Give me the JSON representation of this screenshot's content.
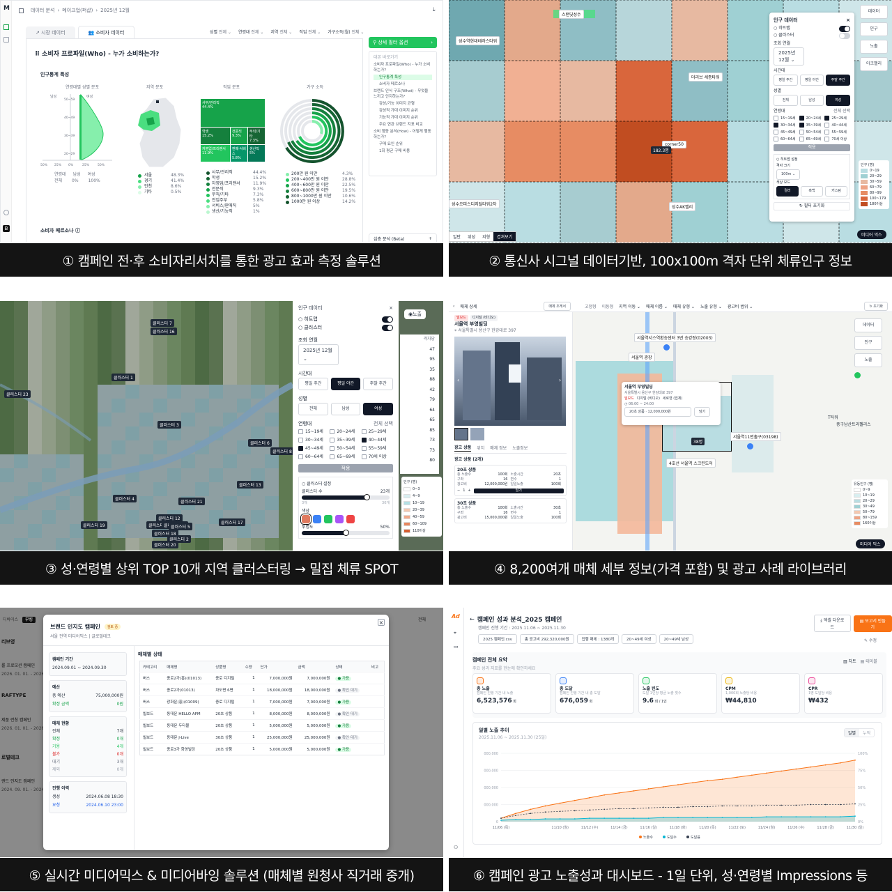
{
  "captions": [
    "① 캠페인 전·후 소비자리서치를 통한 광고 효과 측정 솔루션",
    "② 통신사 시그널 데이터기반, 100x100m 격자 단위 체류인구 정보",
    "③ 성·연령별 상위 TOP 10개 지역 클러스터링 → 밀집 체류 SPOT",
    "④ 8,200여개 매체 세부 정보(가격 포함) 및 광고 사례 라이브러리",
    "⑤ 실시간 미디어믹스 & 미디어바잉 솔루션 (매체별 원청사 직거래 중개)",
    "⑥ 캠페인 광고 노출성과 대시보드 - 1일 단위, 성·연령별 Impressions 등"
  ],
  "p1": {
    "logo": "M",
    "breadcrumb": [
      "데이터 분석",
      "메이크업(퍼샵)",
      "2025년 12월"
    ],
    "tabs": [
      "시장 데이터",
      "소비자 데이터"
    ],
    "filters": [
      {
        "label": "성별",
        "value": "전체"
      },
      {
        "label": "연령대",
        "value": "전체"
      },
      {
        "label": "지역",
        "value": "전체"
      },
      {
        "label": "직업",
        "value": "전체"
      },
      {
        "label": "가구소득(월)",
        "value": "전체"
      }
    ],
    "title": "소비자 프로파일(Who) - 누가 소비하는가?",
    "section": "인구통계 특성",
    "sub_titles": [
      "연령대별 성별 분포",
      "지역 분포",
      "직업 분포",
      "가구 소득"
    ],
    "pyramid_labels": [
      "남성",
      "여성"
    ],
    "pyramid_ages": [
      "50~59",
      "40~49",
      "30~39",
      "20~29"
    ],
    "pyramid_axis": [
      "50%",
      "25%",
      "0%",
      "25%",
      "50%"
    ],
    "pyramid_legend": {
      "headers": [
        "연령대",
        "남성",
        "여성"
      ],
      "row": [
        "전체",
        "0%",
        "100%"
      ]
    },
    "region_legend": [
      {
        "name": "서울",
        "value": "48.3%",
        "color": "#16a34a"
      },
      {
        "name": "경기",
        "value": "41.4%",
        "color": "#4ade80"
      },
      {
        "name": "인천",
        "value": "8.6%",
        "color": "#86efac"
      },
      {
        "name": "기타",
        "value": "0.5%",
        "color": "#dcfce7"
      }
    ],
    "job_tiles": [
      {
        "name": "사무/관리직",
        "value": "44.4%"
      },
      {
        "name": "학생",
        "value": "15.2%"
      },
      {
        "name": "전문직",
        "value": "9.3%"
      },
      {
        "name": "무직/기타",
        "value": "7.3%"
      },
      {
        "name": "자영업/프리랜서",
        "value": "11.9%"
      },
      {
        "name": "판매·서비스",
        "value": "5.8%"
      },
      {
        "name": "생산직",
        "value": "5%"
      }
    ],
    "job_legend": [
      {
        "name": "사무/관리직",
        "value": "44.4%"
      },
      {
        "name": "학생",
        "value": "15.2%"
      },
      {
        "name": "자영업/프리랜서",
        "value": "11.9%"
      },
      {
        "name": "전문직",
        "value": "9.3%"
      },
      {
        "name": "무직/기타",
        "value": "7.3%"
      },
      {
        "name": "전업주부",
        "value": "5.8%"
      },
      {
        "name": "서비스/판매직",
        "value": "5%"
      },
      {
        "name": "생산/기능직",
        "value": "1%"
      }
    ],
    "income_legend": [
      {
        "name": "200만 원 이만",
        "value": "4.3%"
      },
      {
        "name": "200~400만 원 이만",
        "value": "28.8%"
      },
      {
        "name": "400~600만 원 이만",
        "value": "22.5%"
      },
      {
        "name": "600~800만 원 이만",
        "value": "19.5%"
      },
      {
        "name": "800~1000만 원 이만",
        "value": "10.6%"
      },
      {
        "name": "1000만 원 이상",
        "value": "14.2%"
      }
    ],
    "bottom_title": "소비자 페르소나",
    "panel_button": "상세 필터 옵션",
    "toc_header": "대본 바로가기",
    "toc": [
      "소비자 프로파일(Who) - 누가 소비하는가?",
      "인구통계 특성",
      "소비자 페르소나",
      "브랜드 인식 구조(What) - 무엇을 느끼고 인지하는가?",
      "감성/기능 이미지 균형",
      "감성적 가대 이미지 순위",
      "기능적 가대 이미지 순위",
      "주요 연관 브랜드 지표 비교",
      "소비 행동 분석(How) - 어떻게 행동하는가?",
      "구매 요인 순위",
      "1회 평균 구매 비용"
    ],
    "beta_label": "심층 분석 (Beta)"
  },
  "p2": {
    "top_buttons": [
      "데이터",
      "인구",
      "노출",
      "아크밸리"
    ],
    "places": [
      "스탠딧성수",
      "성수역현대테라스타워",
      "더리브 세종타워",
      "corner50",
      "성수AK밸리",
      "성수오피스디지털타워2차"
    ],
    "cell_value": "182.3명",
    "panel_title": "인구 데이터",
    "toggles": [
      {
        "label": "히트맵",
        "on": true
      },
      {
        "label": "클러스터",
        "on": false
      }
    ],
    "month_label": "조회 연월",
    "month": "2025년 12월",
    "time_label": "시간대",
    "times": [
      "평일 주간",
      "평일 야간",
      "주말 주간"
    ],
    "time_active": 2,
    "gender_label": "성별",
    "genders": [
      "전체",
      "남성",
      "여성"
    ],
    "gender_active": 2,
    "age_label": "연령대",
    "age_all": "전체 선택",
    "ages": [
      {
        "label": "15~19세",
        "on": false
      },
      {
        "label": "20~24세",
        "on": true
      },
      {
        "label": "25~29세",
        "on": true
      },
      {
        "label": "30~34세",
        "on": true
      },
      {
        "label": "35~39세",
        "on": true
      },
      {
        "label": "40~44세",
        "on": false
      },
      {
        "label": "45~49세",
        "on": false
      },
      {
        "label": "50~54세",
        "on": false
      },
      {
        "label": "55~59세",
        "on": false
      },
      {
        "label": "60~64세",
        "on": false
      },
      {
        "label": "65~69세",
        "on": false
      },
      {
        "label": "70세 이상",
        "on": false
      }
    ],
    "apply": "적용",
    "heat_label": "히트맵 설정",
    "grid_label": "격자 크기",
    "grid_value": "100m",
    "color_mode_label": "색상 모드",
    "color_modes": [
      "컬러",
      "흑백",
      "커스텀"
    ],
    "reset": "필터 초기화",
    "legend_title": "인구 (명)",
    "legend": [
      {
        "label": "0~19",
        "color": "#b9dde2"
      },
      {
        "label": "20~29",
        "color": "#9fd0d3"
      },
      {
        "label": "30~59",
        "color": "#e7b9a1"
      },
      {
        "label": "60~79",
        "color": "#eea384"
      },
      {
        "label": "80~99",
        "color": "#e78c63"
      },
      {
        "label": "100~179",
        "color": "#d9663c"
      },
      {
        "label": "180이상",
        "color": "#c14d21"
      }
    ],
    "map_tabs": [
      "일반",
      "위성",
      "지형",
      "겹쳐보기"
    ],
    "mix_button": "미디어 믹스"
  },
  "p3": {
    "clusters": [
      "클러스터 7",
      "클러스터 16",
      "클러스터 1",
      "클러스터 23",
      "클러스터 3",
      "클러스터 6",
      "클러스터 8",
      "클러스터 13",
      "클러스터 4",
      "클러스터 21",
      "클러스터 12",
      "클러스터 11",
      "클러스터 10",
      "클러스터 5",
      "클러스터 17",
      "클러스터 19",
      "클러스터 18",
      "클러스터 2",
      "클러스터 20"
    ],
    "panel_title": "인구 데이터",
    "toggles": [
      {
        "label": "히트맵",
        "on": true
      },
      {
        "label": "클러스터",
        "on": true
      }
    ],
    "month_label": "조회 연월",
    "month": "2025년 12월",
    "time_label": "시간대",
    "times": [
      "평일 주간",
      "평일 야간",
      "주말 주간"
    ],
    "time_active": 1,
    "gender_label": "성별",
    "genders": [
      "전체",
      "남성",
      "여성"
    ],
    "gender_active": 2,
    "age_label": "연령대",
    "age_all": "전체 선택",
    "ages": [
      {
        "label": "15~19세",
        "on": false
      },
      {
        "label": "20~24세",
        "on": false
      },
      {
        "label": "25~29세",
        "on": false
      },
      {
        "label": "30~34세",
        "on": false
      },
      {
        "label": "35~39세",
        "on": false
      },
      {
        "label": "40~44세",
        "on": true
      },
      {
        "label": "45~49세",
        "on": true
      },
      {
        "label": "50~54세",
        "on": false
      },
      {
        "label": "55~59세",
        "on": false
      },
      {
        "label": "60~64세",
        "on": false
      },
      {
        "label": "65~69세",
        "on": false
      },
      {
        "label": "70세 이상",
        "on": false
      }
    ],
    "apply": "적용",
    "cluster_setting": "클러스터 설정",
    "cluster_count_label": "클러스터 수",
    "cluster_count": "23개",
    "slider_min": "3개",
    "slider_max": "30개",
    "color_label": "색상",
    "colors": [
      "#e07a5f",
      "#3b82f6",
      "#22c55e",
      "#a855f7",
      "#ef4444"
    ],
    "opacity_label": "투명도",
    "opacity": "50%",
    "opacity_value": 0.5,
    "cluster_count_value": 23,
    "side_header": "격자당",
    "side_values": [
      "47",
      "95",
      "35",
      "88",
      "42",
      "79",
      "64",
      "65",
      "85",
      "73",
      "73",
      "80"
    ],
    "legend_title": "인구 (명)",
    "legend": [
      "0~3",
      "4~9",
      "10~19",
      "20~39",
      "40~59",
      "60~109",
      "110이상"
    ],
    "legend_colors": [
      "#ffffff",
      "#d8eef0",
      "#b4e0e4",
      "#f4c8b0",
      "#f1a98a",
      "#e8875f",
      "#d55f33"
    ],
    "top_button": "노출"
  },
  "p4": {
    "header_title": "매체 상세",
    "header_button": "매체 조게서",
    "filters": [
      "고정형",
      "이동형",
      "지역 이동",
      "매체 이름",
      "매체 유형",
      "노출 유형",
      "광고비 범위"
    ],
    "reset": "초기화",
    "badges": [
      "빌보드",
      "디지털 (비디오)"
    ],
    "name": "서울역 부영빌딩",
    "address": "서울특별시 용산구 한강대로 397",
    "tabs": [
      "광고 상품",
      "위치",
      "매체 정보",
      "노출정보"
    ],
    "product_header": "광고 상품 (2개)",
    "products": [
      {
        "title": "20초 상품",
        "rows": [
          [
            "총 노출수",
            "100회"
          ],
          [
            "노출시간",
            "20초"
          ],
          [
            "구좌",
            "16"
          ],
          [
            "면수",
            "1"
          ],
          [
            "광고비",
            "12,000,000원"
          ],
          [
            "일일노출",
            "100회"
          ]
        ]
      },
      {
        "title": "30초 상품",
        "rows": [
          [
            "총 노출수",
            "100회"
          ],
          [
            "노출시간",
            "30초"
          ],
          [
            "구좌",
            "16"
          ],
          [
            "면수",
            "1"
          ],
          [
            "광고비",
            "15,000,000원"
          ],
          [
            "일일노출",
            "100회"
          ]
        ]
      }
    ],
    "qty": "1",
    "add": "담기",
    "popup": {
      "title": "서울역 부영빌딩",
      "address": "서울특별시 용산구 한강대로 397",
      "tags": [
        "빌보드",
        "디지털 (비디오)",
        "세로형 (입체)"
      ],
      "time": "06:00 ~ 24:00",
      "product": "20초 상품 · 12,000,000원",
      "button": "담기"
    },
    "map_labels": [
      "서울역서스역환승센터 3번 승강장(02003)",
      "서울역 광장",
      "서울역11번출구(03198)",
      "4호선 서울역 스크린도어",
      "T타워",
      "중구남산트라펠리스",
      "38명"
    ],
    "top_buttons": [
      "데이터",
      "인구",
      "노출"
    ],
    "legend_title": "유동인구 (명)",
    "legend": [
      "0~9",
      "10~19",
      "20~29",
      "30~49",
      "50~79",
      "80~159",
      "160이상"
    ],
    "mix_button": "미디어 믹스"
  },
  "p5": {
    "bg_items": [
      "리브영",
      "롤 프로모션 캠페인",
      "RAFTYPE",
      "제품 런칭 캠페인",
      "로벌테크",
      "랜드 인지도 캠페인"
    ],
    "bg_dates": [
      "2026. 01. 01. - 2026.",
      "2026. 01. 01. - 2026.",
      "2024. 09. 01. - 2024."
    ],
    "bg_tab": "전체",
    "modal_title": "브랜드 인지도 캠페인",
    "modal_badge": "검토 중",
    "modal_sub": "서울 전역 미디어믹스 | 글로벌테크",
    "period_label": "캠페인 기간",
    "period": "2024.09.01 ~ 2024.09.30",
    "budget_label": "예산",
    "budget_rows": [
      [
        "총 예산",
        "75,000,000원"
      ],
      [
        "확정 금액",
        "0원"
      ]
    ],
    "media_label": "매체 현황",
    "media_rows": [
      [
        "전체",
        "7개"
      ],
      [
        "확정",
        "0개"
      ],
      [
        "가용",
        "4개"
      ],
      [
        "불가",
        "0개"
      ],
      [
        "대기",
        "3개"
      ],
      [
        "제외",
        "0개"
      ]
    ],
    "history_label": "진행 이력",
    "history_rows": [
      [
        "생성",
        "2024.06.08 18:30"
      ],
      [
        "요청",
        "2024.06.10 23:00"
      ]
    ],
    "table_title": "매체별 상태",
    "columns": [
      "카테고리",
      "매체명",
      "상품명",
      "수량",
      "단가",
      "금액",
      "상태",
      "비고"
    ],
    "rows": [
      [
        "버스",
        "종로2가(홍)(01013)",
        "종로 디지털",
        "1",
        "7,000,000원",
        "7,000,000원",
        "가용"
      ],
      [
        "버스",
        "종로2가(01013)",
        "차도면 6면",
        "1",
        "18,000,000원",
        "18,000,000원",
        "확인 대기"
      ],
      [
        "버스",
        "광화문(홍)(01009)",
        "종로 디지털",
        "1",
        "7,000,000원",
        "7,000,000원",
        "가용"
      ],
      [
        "빌보드",
        "동대문 HELLO APM",
        "20초 상품",
        "1",
        "8,000,000원",
        "8,000,000원",
        "확인 대기"
      ],
      [
        "빌보드",
        "동대문 두타몰",
        "20초 상품",
        "1",
        "5,000,000원",
        "5,000,000원",
        "가용"
      ],
      [
        "빌보드",
        "동대문 J-Live",
        "30초 상품",
        "1",
        "25,000,000원",
        "25,000,000원",
        "확인 대기"
      ],
      [
        "빌보드",
        "종로3가 화영빌딩",
        "20초 상품",
        "1",
        "5,000,000원",
        "5,000,000원",
        "가용"
      ]
    ]
  },
  "p6": {
    "logo": "Ad",
    "title": "캠페인 성과 분석_2025 캠페인",
    "period": "캠페인 진행 기간 : 2025.11.06 ~ 2025.11.30",
    "buttons": [
      "엑셀 다운로드",
      "보고서 만들기"
    ],
    "chips": [
      "2025 캠페인.csv",
      "총 광고비 292,320,000원",
      "집행 매체 : 1380개",
      "20~49세 여성",
      "20~49세 남성"
    ],
    "edit": "수정",
    "summary_title": "캠페인 전체 요약",
    "summary_sub": "주요 성과 지표를 한눈에 확인하세요",
    "view_toggle": [
      "차트",
      "테이블"
    ],
    "kpis": [
      {
        "label": "총 노출",
        "desc": "캠페인 진행 기간 내 노출",
        "value": "6,523,576",
        "unit": "회",
        "color": "#f97316"
      },
      {
        "label": "총 도달",
        "desc": "캠페인 진행 기간 내 총 도달",
        "value": "676,059",
        "unit": "회",
        "color": "#3b82f6"
      },
      {
        "label": "노출 빈도",
        "desc": "도달 1인당 평균 노출 횟수",
        "value": "9.6",
        "unit": "회 / 1인",
        "color": "#22c55e"
      },
      {
        "label": "CPM",
        "desc": "1,000회 노출당 비용",
        "value": "₩44,810",
        "unit": "",
        "color": "#eab308"
      },
      {
        "label": "CPR",
        "desc": "1명 도달당 비용",
        "value": "₩432",
        "unit": "",
        "color": "#ec4899"
      }
    ],
    "chart_title": "일별 노출 추이",
    "chart_sub": "2025.11.06 ~ 2025.11.30 (25일)",
    "chart_toggle": [
      "일별",
      "누적"
    ]
  },
  "chart_data": {
    "type": "area",
    "x": [
      "11/06 (목)",
      "11/07",
      "11/08",
      "11/09",
      "11/10 (월)",
      "11/11",
      "11/12 (수)",
      "11/13",
      "11/14 (금)",
      "11/15",
      "11/16 (일)",
      "11/17",
      "11/18 (화)",
      "11/19",
      "11/20 (목)",
      "11/21",
      "11/22 (토)",
      "11/23",
      "11/24 (월)",
      "11/25",
      "11/26 (수)",
      "11/27",
      "11/28 (금)",
      "11/29",
      "11/30 (일)"
    ],
    "xticks": [
      "11/06 (목)",
      "11/10 (월)",
      "11/12 (수)",
      "11/14 (금)",
      "11/16 (일)",
      "11/18 (화)",
      "11/20 (목)",
      "11/22 (토)",
      "11/24 (월)",
      "11/26 (수)",
      "11/28 (금)",
      "11/30 (일)"
    ],
    "series": [
      {
        "name": "노출수",
        "color": "#f97316",
        "values": [
          0.05,
          0.12,
          0.18,
          0.23,
          0.27,
          0.31,
          0.35,
          0.39,
          0.42,
          0.45,
          0.48,
          0.51,
          0.54,
          0.57,
          0.6,
          0.62,
          0.65,
          0.68,
          0.71,
          0.74,
          0.77,
          0.8,
          0.83,
          0.86,
          0.9
        ]
      },
      {
        "name": "도달수",
        "color": "#06b6d4",
        "values": [
          0.02,
          0.03,
          0.03,
          0.04,
          0.04,
          0.04,
          0.05,
          0.05,
          0.05,
          0.05,
          0.05,
          0.06,
          0.06,
          0.06,
          0.06,
          0.06,
          0.06,
          0.06,
          0.07,
          0.07,
          0.07,
          0.07,
          0.07,
          0.07,
          0.08
        ]
      },
      {
        "name": "도달률",
        "color": "#374151",
        "values": [
          0.05,
          0.09,
          0.12,
          0.14,
          0.15,
          0.16,
          0.17,
          0.18,
          0.19,
          0.19,
          0.2,
          0.21,
          0.21,
          0.22,
          0.22,
          0.23,
          0.23,
          0.23,
          0.24,
          0.24,
          0.24,
          0.25,
          0.25,
          0.25,
          0.26
        ]
      }
    ],
    "yticks_left": [
      "000,000",
      "000,000",
      "000,000",
      "000,000",
      "0"
    ],
    "yticks_right": [
      "100%",
      "75%",
      "50%",
      "25%",
      "0%"
    ],
    "ylim": [
      0,
      1
    ],
    "legend": "bottom"
  }
}
